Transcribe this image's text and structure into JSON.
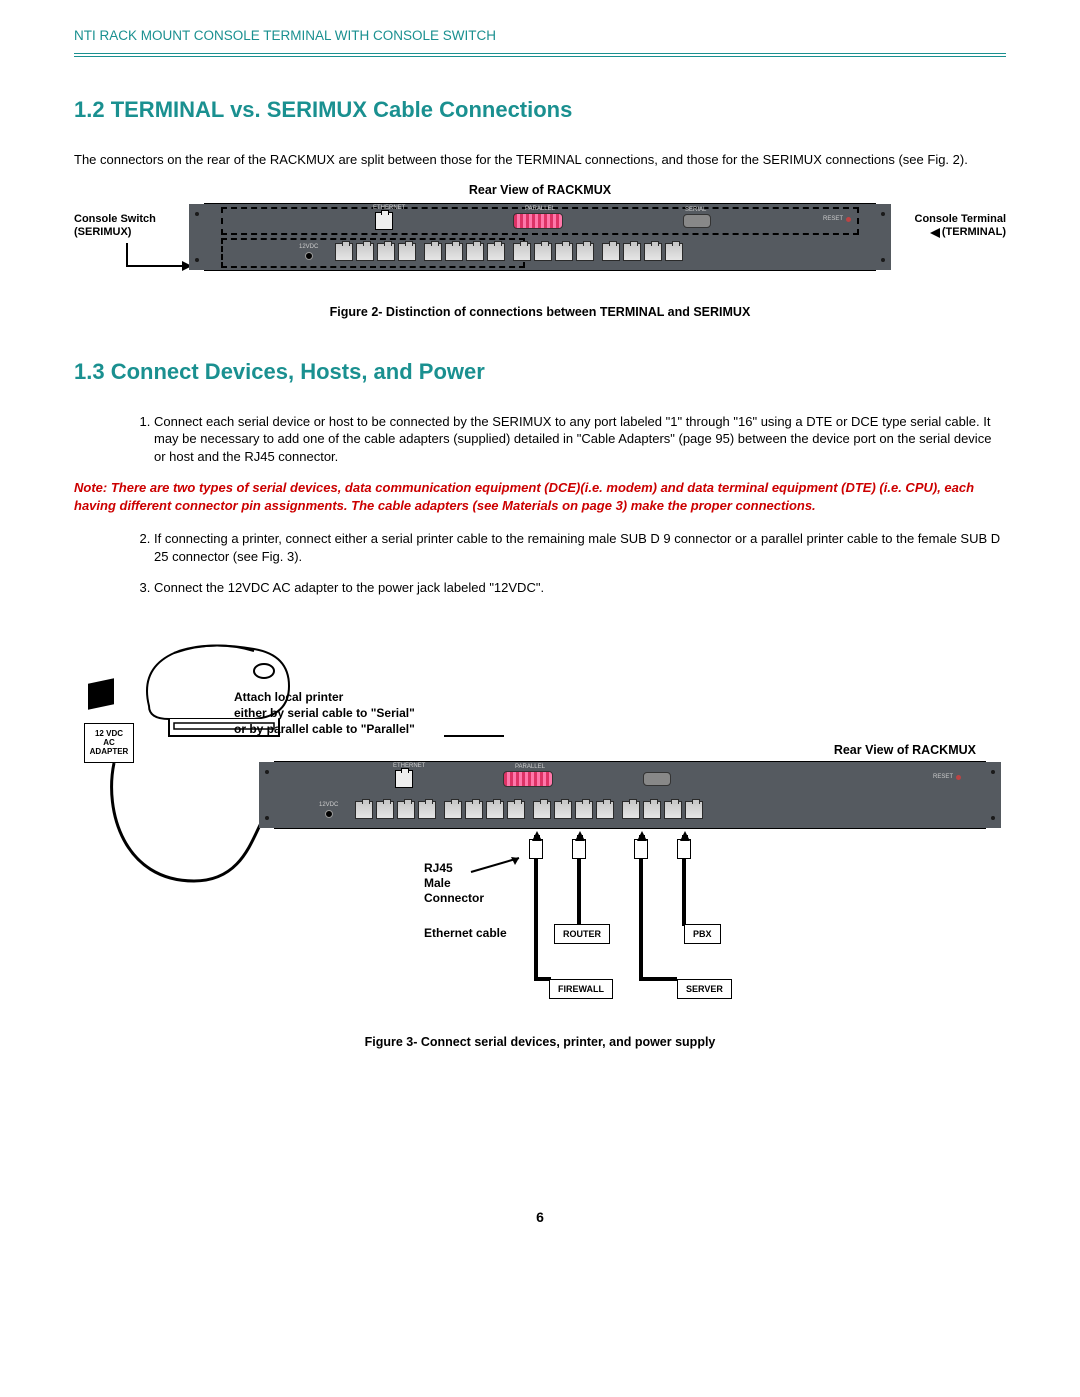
{
  "header": {
    "running_head": "NTI RACK MOUNT CONSOLE TERMINAL WITH CONSOLE SWITCH"
  },
  "section12": {
    "title": "1.2 TERMINAL vs. SERIMUX Cable Connections",
    "intro": "The connectors on the rear of the RACKMUX are split between those for the TERMINAL connections, and those for the SERIMUX connections (see Fig. 2)."
  },
  "figure2": {
    "rear_title": "Rear View of RACKMUX",
    "left_label_line1": "Console Switch",
    "left_label_line2": "(SERIMUX)",
    "right_label_line1": "Console Terminal",
    "right_label_line2": "(TERMINAL)",
    "ethernet_label": "ETHERNET",
    "parallel_label": "PARALLEL",
    "serial_label": "SERIAL",
    "reset_label": "RESET",
    "power_label": "12VDC",
    "caption": "Figure 2- Distinction of connections between TERMINAL and SERIMUX"
  },
  "section13": {
    "title": "1.3 Connect Devices, Hosts, and Power",
    "item1": "Connect each serial device or host to be connected by the SERIMUX to any port labeled \"1\"  through \"16\" using a DTE or DCE type serial cable.  It may be necessary to add one of the cable adapters (supplied) detailed in \"Cable Adapters\" (page 95) between the device port on the serial device or host and the RJ45 connector.",
    "note": "Note:  There are two types of serial devices, data communication equipment (DCE)(i.e. modem) and data terminal equipment (DTE) (i.e. CPU), each having different connector pin assignments.  The cable adapters (see Materials on page 3) make the proper connections.",
    "item2": "If connecting a printer,  connect either a serial printer cable to the remaining male SUB D 9 connector or a parallel printer cable to the female SUB D 25 connector (see Fig. 3).",
    "item3": "Connect the 12VDC AC adapter to the power jack labeled \"12VDC\"."
  },
  "figure3": {
    "adapter_line1": "12 VDC",
    "adapter_line2": "AC",
    "adapter_line3": "ADAPTER",
    "attach_line1": "Attach local printer",
    "attach_line2": "either by serial cable to \"Serial\"",
    "attach_line3": "or by parallel cable to \"Parallel\"",
    "rear_title": "Rear View of RACKMUX",
    "rj45_line1": "RJ45",
    "rj45_line2": "Male",
    "rj45_line3": "Connector",
    "eth_cable": "Ethernet cable",
    "router": "ROUTER",
    "firewall": "FIREWALL",
    "pbx": "PBX",
    "server": "SERVER",
    "reset_label": "RESET",
    "ethernet_label": "ETHERNET",
    "parallel_label": "PARALLEL",
    "power_label": "12VDC",
    "caption": "Figure 3- Connect serial devices, printer, and power supply"
  },
  "page_number": "6"
}
